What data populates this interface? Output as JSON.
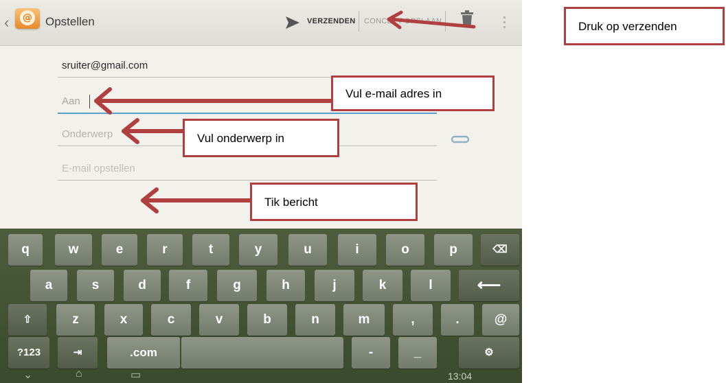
{
  "actionbar": {
    "back_glyph": "‹",
    "app_icon_glyph": "@",
    "title": "Opstellen",
    "send_label": "VERZENDEN",
    "draft_label": "CONCEPT OPSLAAN"
  },
  "form": {
    "from_value": "sruiter@gmail.com",
    "to_placeholder": "Aan",
    "subject_placeholder": "Onderwerp",
    "body_placeholder": "E-mail opstellen"
  },
  "keyboard": {
    "row1": [
      "q",
      "w",
      "e",
      "r",
      "t",
      "y",
      "u",
      "i",
      "o",
      "p"
    ],
    "backspace_glyph": "⌫",
    "row2": [
      "a",
      "s",
      "d",
      "f",
      "g",
      "h",
      "j",
      "k",
      "l"
    ],
    "enter_glyph": "⟵",
    "shift_glyph": "⇧",
    "row3": [
      "z",
      "x",
      "c",
      "v",
      "b",
      "n",
      "m",
      ",",
      ".",
      "@"
    ],
    "row4": {
      "symbols": "?123",
      "tab_glyph": "⇥",
      "com": ".com",
      "dash": "-",
      "underscore": "_",
      "settings_glyph": "⚙"
    }
  },
  "navbar": {
    "back": "⌄",
    "home": "⌂",
    "recents": "▭",
    "clock": "13:04"
  },
  "callouts": {
    "send": "Druk op verzenden",
    "email": "Vul e-mail adres in",
    "subject": "Vul onderwerp in",
    "message": "Tik bericht"
  },
  "colors": {
    "annotation_red": "#b04040",
    "focus_blue": "#5aa0c8",
    "keyboard_green": "#4c5c3c"
  }
}
